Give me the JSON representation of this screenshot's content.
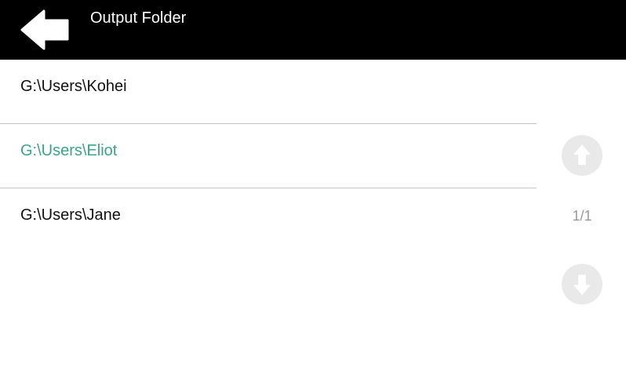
{
  "header": {
    "title": "Output Folder",
    "back_icon": "back-arrow-icon"
  },
  "folders": [
    {
      "label": "G:\\Users\\Kohei",
      "selected": false
    },
    {
      "label": "G:\\Users\\Eliot",
      "selected": true
    },
    {
      "label": "G:\\Users\\Jane",
      "selected": false
    }
  ],
  "pagination": {
    "indicator": "1/1",
    "up_icon": "arrow-up-icon",
    "down_icon": "arrow-down-icon"
  },
  "colors": {
    "header_background": "#000000",
    "selected_text": "#3aa487",
    "divider": "#c4c4c4",
    "scroll_button": "#e9e9e9",
    "page_indicator": "#9a9a9a"
  }
}
